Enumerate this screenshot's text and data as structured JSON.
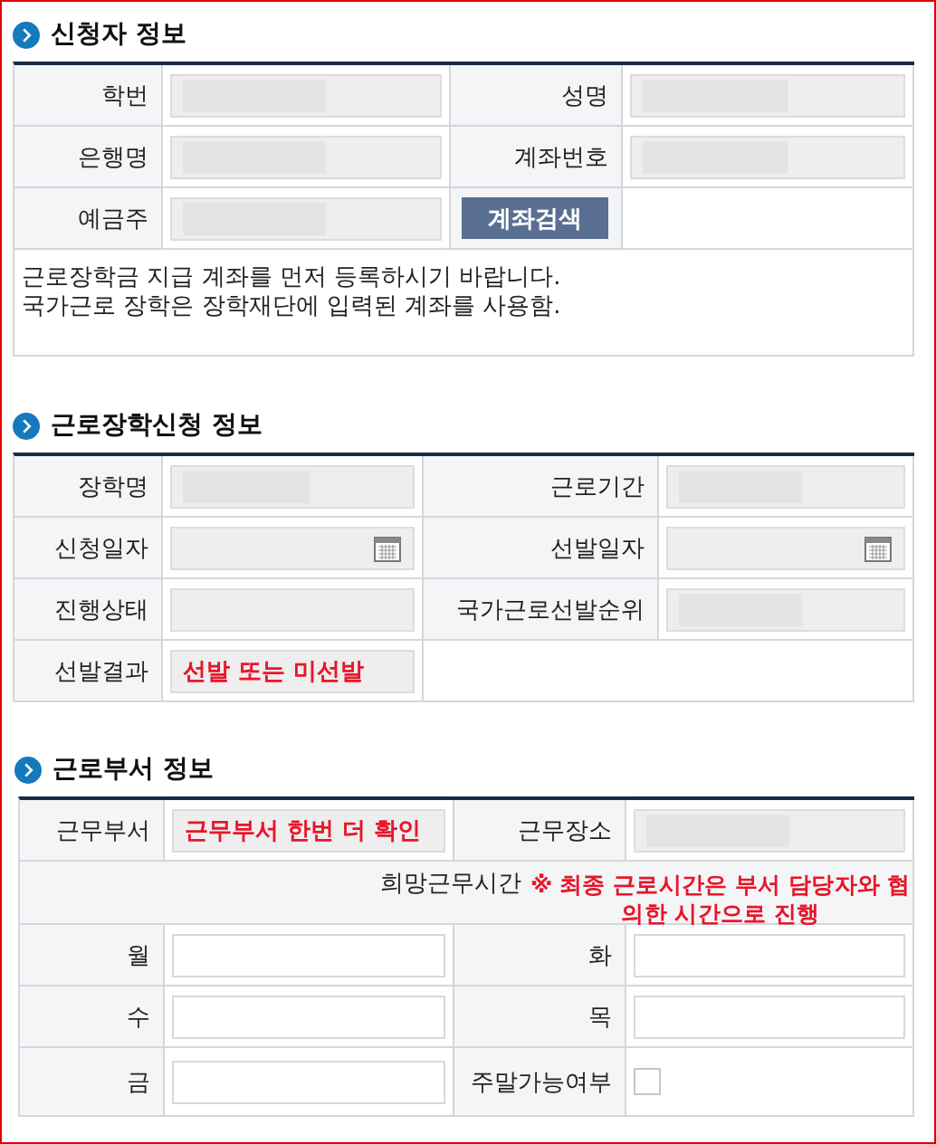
{
  "sections": [
    {
      "title": "신청자 정보",
      "rows": [
        [
          {
            "kind": "label",
            "text": "학번"
          },
          {
            "kind": "field",
            "masked": true
          },
          {
            "kind": "label",
            "text": "성명"
          },
          {
            "kind": "field",
            "masked": true
          }
        ],
        [
          {
            "kind": "label",
            "text": "은행명"
          },
          {
            "kind": "field",
            "masked": true
          },
          {
            "kind": "label",
            "text": "계좌번호"
          },
          {
            "kind": "field",
            "masked": true
          }
        ],
        [
          {
            "kind": "label",
            "text": "예금주"
          },
          {
            "kind": "field",
            "masked": true
          },
          {
            "kind": "button",
            "text": "계좌검색"
          },
          {
            "kind": "empty"
          }
        ],
        [
          {
            "kind": "note",
            "lines": [
              "근로장학금 지급 계좌를 먼저 등록하시기 바랍니다.",
              "국가근로 장학은 장학재단에 입력된 계좌를 사용함."
            ]
          }
        ]
      ]
    },
    {
      "title": "근로장학신청 정보",
      "rows": [
        [
          {
            "kind": "label",
            "text": "장학명"
          },
          {
            "kind": "field",
            "masked": true
          },
          {
            "kind": "label",
            "text": "근로기간"
          },
          {
            "kind": "field",
            "masked": true
          }
        ],
        [
          {
            "kind": "label",
            "text": "신청일자"
          },
          {
            "kind": "field",
            "calendar": true
          },
          {
            "kind": "label",
            "text": "선발일자"
          },
          {
            "kind": "field",
            "calendar": true
          }
        ],
        [
          {
            "kind": "label",
            "text": "진행상태"
          },
          {
            "kind": "field"
          },
          {
            "kind": "label",
            "text": "국가근로선발순위"
          },
          {
            "kind": "field",
            "masked": true
          }
        ],
        [
          {
            "kind": "label",
            "text": "선발결과"
          },
          {
            "kind": "field",
            "value": "선발 또는 미선발"
          },
          {
            "kind": "empty"
          }
        ]
      ]
    },
    {
      "title": "근로부서 정보",
      "rows": [
        [
          {
            "kind": "label",
            "text": "근무부서"
          },
          {
            "kind": "field",
            "value": "근무부서 한번 더 확인"
          },
          {
            "kind": "label",
            "text": "근무장소"
          },
          {
            "kind": "field",
            "masked": true
          }
        ],
        [
          {
            "kind": "empty"
          },
          {
            "kind": "hours",
            "text": "희망근무시간",
            "note": "※ 최종 근로시간은 부서 담당자와 협의한 시간으로 진행"
          }
        ],
        [
          {
            "kind": "label",
            "text": "월"
          },
          {
            "kind": "input"
          },
          {
            "kind": "label",
            "text": "화"
          },
          {
            "kind": "input"
          }
        ],
        [
          {
            "kind": "label",
            "text": "수"
          },
          {
            "kind": "input"
          },
          {
            "kind": "label",
            "text": "목"
          },
          {
            "kind": "input"
          }
        ],
        [
          {
            "kind": "label",
            "text": "금"
          },
          {
            "kind": "input"
          },
          {
            "kind": "label",
            "text": "주말가능여부"
          },
          {
            "kind": "checkbox",
            "checked": false
          }
        ]
      ]
    }
  ]
}
